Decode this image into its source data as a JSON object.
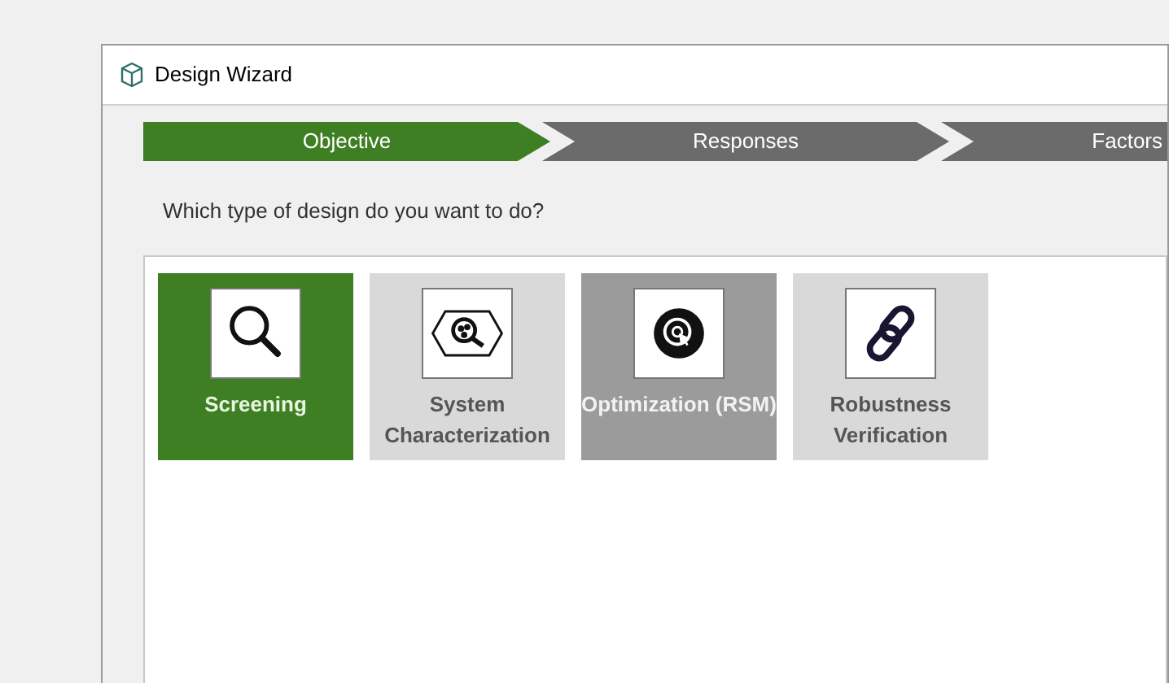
{
  "window": {
    "title": "Design Wizard"
  },
  "steps": [
    {
      "label": "Objective",
      "selected": true
    },
    {
      "label": "Responses",
      "selected": false
    },
    {
      "label": "Factors",
      "selected": false
    }
  ],
  "question": "Which type of design do you want to do?",
  "design_types": [
    {
      "kind": "screening",
      "label": "Screening",
      "selected": true,
      "hovered": false
    },
    {
      "kind": "characterization",
      "label": "System Characterization",
      "selected": false,
      "hovered": false
    },
    {
      "kind": "optimization",
      "label": "Optimization (RSM)",
      "selected": false,
      "hovered": true
    },
    {
      "kind": "robustness",
      "label": "Robustness Verification",
      "selected": false,
      "hovered": false
    }
  ]
}
